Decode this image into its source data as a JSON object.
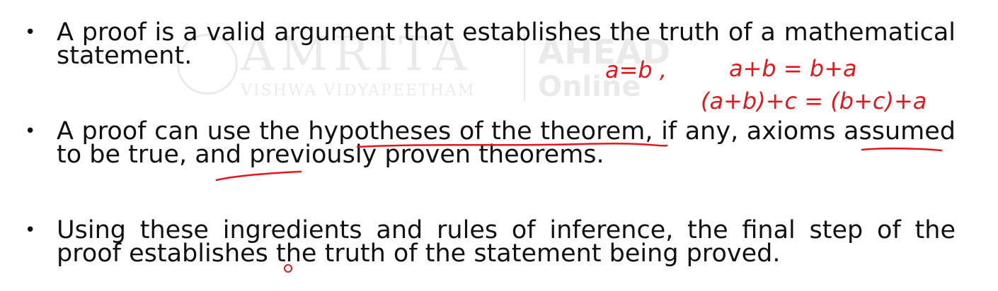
{
  "watermark": {
    "brand": "AMRITA",
    "subtitle": "VISHWA VIDYAPEETHAM",
    "ahead": "AHEAD",
    "online": "Online"
  },
  "points": [
    {
      "text": "A proof is a valid argument that establishes the truth of a mathematical statement."
    },
    {
      "text": "A proof can use the hypotheses of the theorem, if any, axioms assumed to be true, and previously proven theorems."
    },
    {
      "text": "Using these ingredients and rules of inference, the final step of the proof establishes the truth of the statement being proved."
    }
  ],
  "bullet_glyph": "•",
  "annotations": {
    "color": "#e8141b",
    "eq1": "a=b ,",
    "eq2": "a+b = b+a",
    "eq3": "(a+b)+c = (b+c)+a"
  }
}
